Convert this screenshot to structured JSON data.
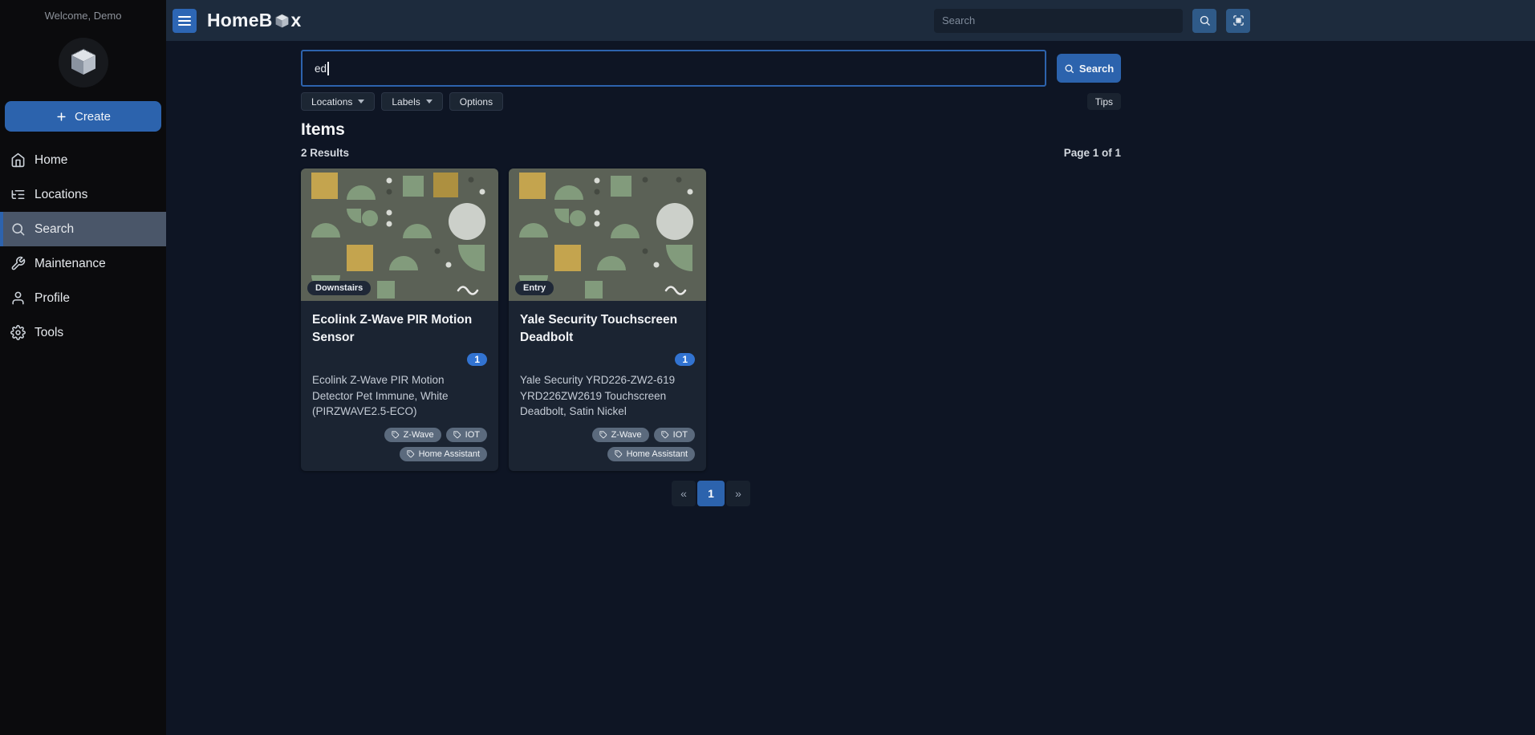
{
  "sidebar": {
    "welcome": "Welcome, Demo",
    "create_label": "Create",
    "nav": [
      {
        "label": "Home"
      },
      {
        "label": "Locations"
      },
      {
        "label": "Search"
      },
      {
        "label": "Maintenance"
      },
      {
        "label": "Profile"
      },
      {
        "label": "Tools"
      }
    ]
  },
  "header": {
    "brand_full": "HomeBox",
    "brand_pre": "HomeB",
    "brand_post": "x",
    "search_placeholder": "Search"
  },
  "search": {
    "query": "ed",
    "button_label": "Search",
    "filters": {
      "locations": "Locations",
      "labels": "Labels",
      "options": "Options"
    },
    "tips_label": "Tips"
  },
  "results": {
    "heading": "Items",
    "count": "2 Results",
    "page": "Page 1 of 1"
  },
  "items": [
    {
      "location": "Downstairs",
      "title": "Ecolink Z-Wave PIR Motion Sensor",
      "quantity": "1",
      "description": "Ecolink Z-Wave PIR Motion Detector Pet Immune, White (PIRZWAVE2.5-ECO)",
      "labels": [
        "Z-Wave",
        "IOT",
        "Home Assistant"
      ]
    },
    {
      "location": "Entry",
      "title": "Yale Security Touchscreen Deadbolt",
      "quantity": "1",
      "description": "Yale Security YRD226-ZW2-619 YRD226ZW2619 Touchscreen Deadbolt, Satin Nickel",
      "labels": [
        "Z-Wave",
        "IOT",
        "Home Assistant"
      ]
    }
  ],
  "pagination": {
    "prev": "«",
    "current": "1",
    "next": "»"
  },
  "icons": {
    "menu": "hamburger-lines",
    "search": "magnifier",
    "scan": "qr-scan-brackets",
    "create": "plus",
    "home": "house",
    "locations": "tree-list",
    "maintenance": "wrench",
    "profile": "person",
    "tools": "gear",
    "label": "tag",
    "dropdown": "caret-down"
  },
  "colors": {
    "accent": "#2c63ad",
    "badge_blue": "#3273d1",
    "topbar": "#1d2b3d",
    "page_bg": "#0e1524",
    "card_bg": "#1b2432",
    "sidebar_bg": "#0b0b0d",
    "chip_bg": "#5b6a7d"
  }
}
